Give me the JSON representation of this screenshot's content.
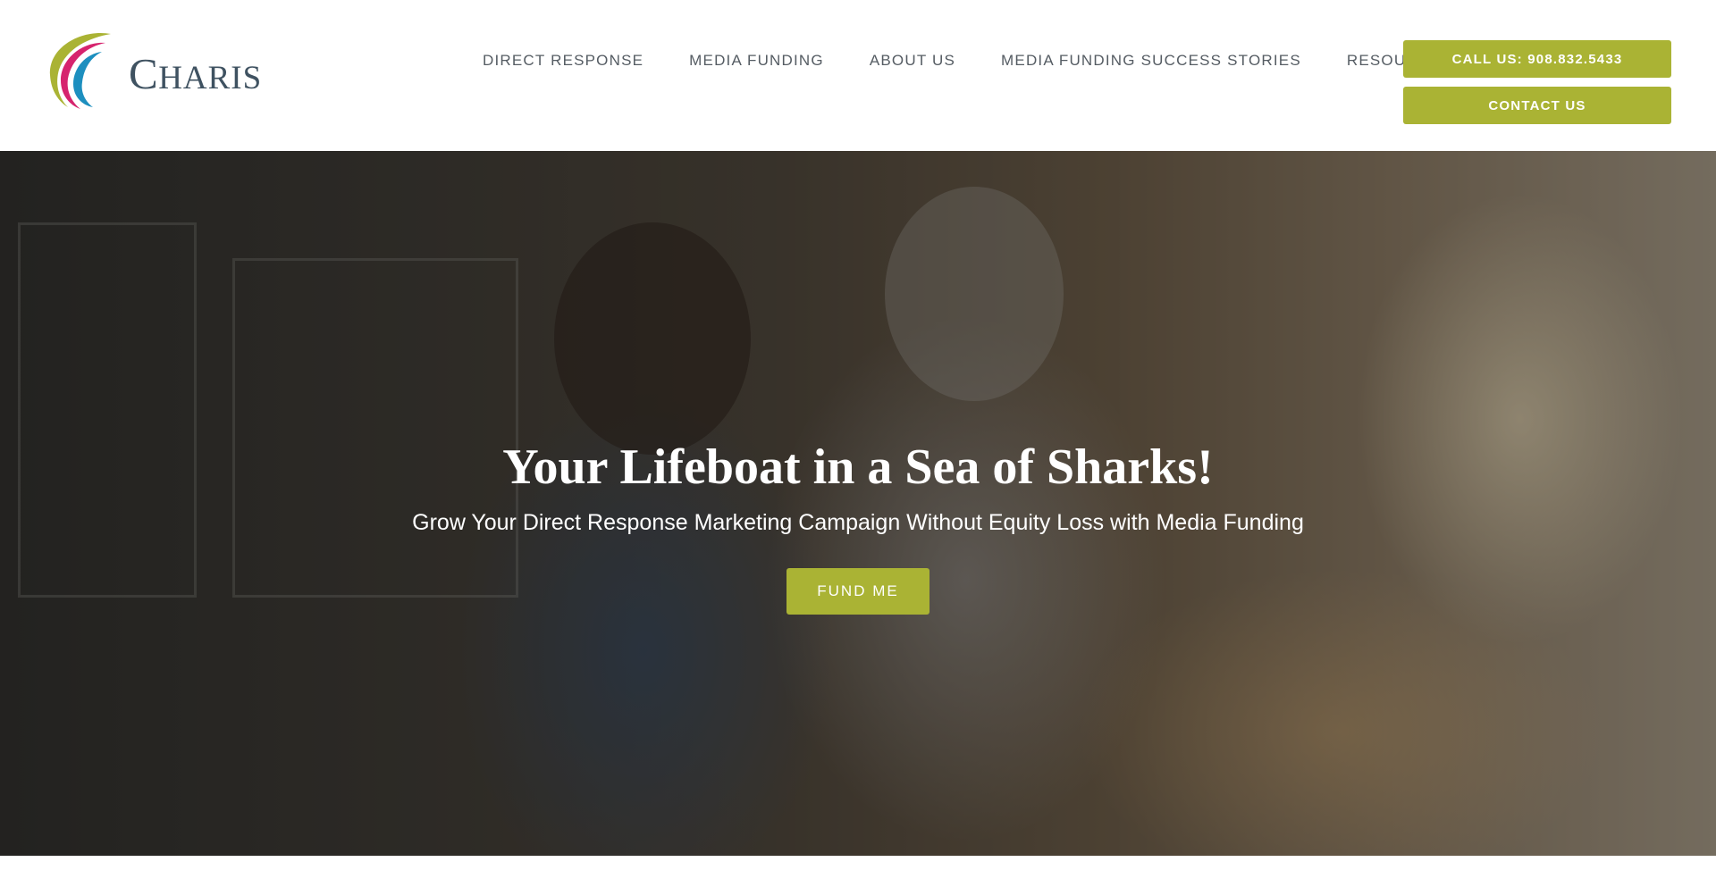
{
  "logo": {
    "text": "CHARIS",
    "brand_colors": [
      "#aab334",
      "#d6246e",
      "#1d8fbf",
      "#3f5261"
    ]
  },
  "nav": {
    "items": [
      {
        "label": "DIRECT RESPONSE"
      },
      {
        "label": "MEDIA FUNDING"
      },
      {
        "label": "ABOUT US"
      },
      {
        "label": "MEDIA FUNDING SUCCESS STORIES"
      },
      {
        "label": "RESOURCES",
        "icon": "chevron-down-icon"
      }
    ]
  },
  "header_buttons": {
    "call": "CALL US: 908.832.5433",
    "contact": "CONTACT US"
  },
  "hero": {
    "title": "Your Lifeboat in a Sea of Sharks!",
    "subtitle": "Grow Your Direct Response Marketing Campaign Without Equity Loss with Media Funding",
    "cta": "FUND ME"
  },
  "colors": {
    "accent": "#aab334",
    "nav_text": "#555c63",
    "background": "#ffffff"
  }
}
